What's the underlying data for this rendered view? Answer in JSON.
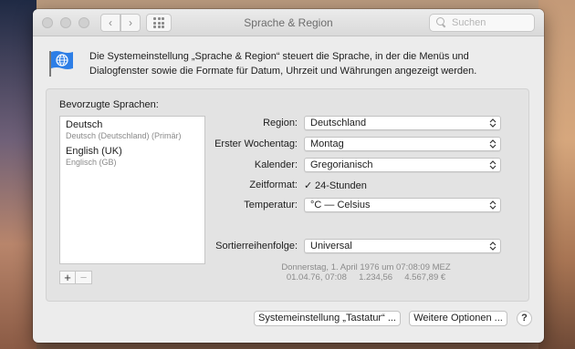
{
  "window": {
    "title": "Sprache & Region",
    "search_placeholder": "Suchen"
  },
  "description": "Die Systemeinstellung „Sprache & Region“ steuert die Sprache, in der die Menüs und Dialogfenster sowie die Formate für Datum, Uhrzeit und Währungen angezeigt werden.",
  "languages": {
    "label": "Bevorzugte Sprachen:",
    "items": [
      {
        "name": "Deutsch",
        "detail": "Deutsch (Deutschland) (Primär)"
      },
      {
        "name": "English (UK)",
        "detail": "Englisch (GB)"
      }
    ],
    "add": "+",
    "remove": "−"
  },
  "settings": {
    "region": {
      "label": "Region:",
      "value": "Deutschland"
    },
    "weekday": {
      "label": "Erster Wochentag:",
      "value": "Montag"
    },
    "calendar": {
      "label": "Kalender:",
      "value": "Gregorianisch"
    },
    "timeformat": {
      "label": "Zeitformat:",
      "check": "✓",
      "value": "24-Stunden"
    },
    "temperature": {
      "label": "Temperatur:",
      "value": "°C — Celsius"
    },
    "sort": {
      "label": "Sortierreihenfolge:",
      "value": "Universal"
    }
  },
  "format_preview": {
    "line1": "Donnerstag, 1. April 1976 um 07:08:09 MEZ",
    "line2": "01.04.76, 07:08     1.234,56     4.567,89 €"
  },
  "buttons": {
    "keyboard": "Systemeinstellung „Tastatur“ ...",
    "advanced": "Weitere Optionen ...",
    "help": "?"
  },
  "colors": {
    "flag_blue": "#2d7ee6"
  }
}
